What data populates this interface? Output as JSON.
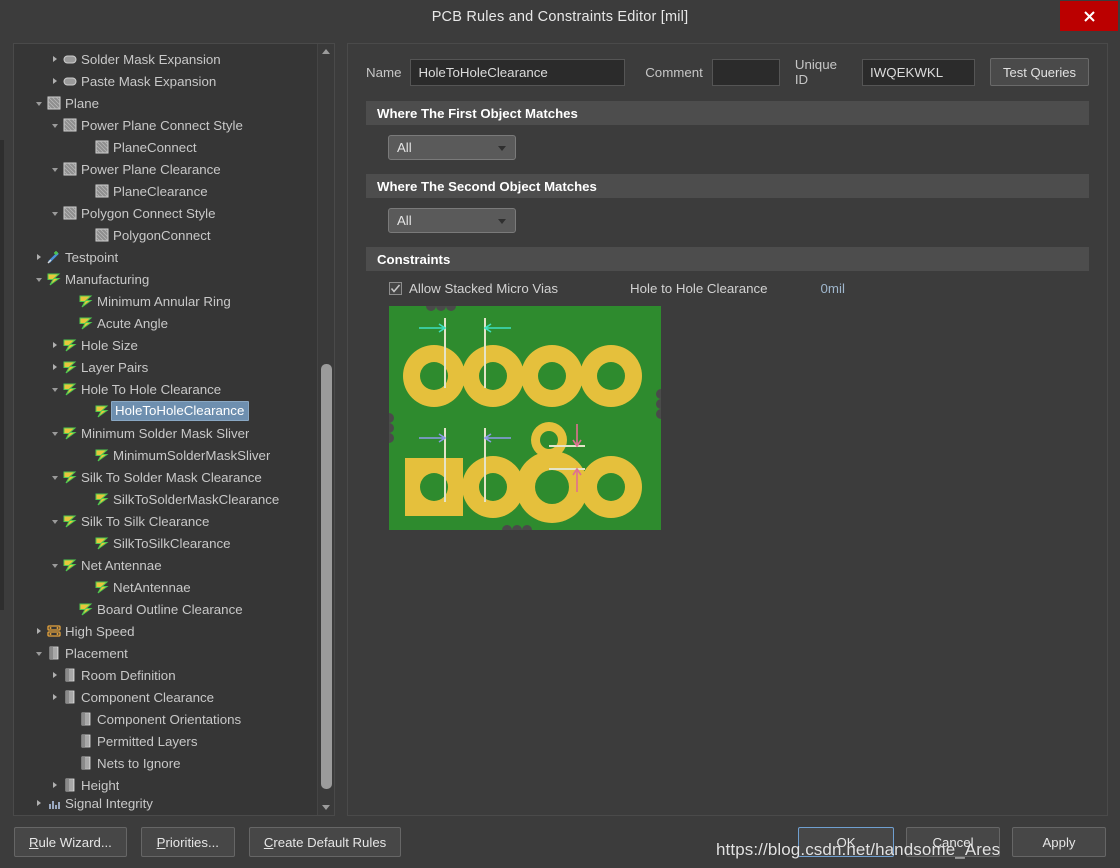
{
  "window": {
    "title": "PCB Rules and Constraints Editor [mil]",
    "close_label": "x",
    "accent_close_color": "#bb0000",
    "selection_color": "#6e8faf"
  },
  "tree": {
    "items": [
      {
        "label": "Solder Mask Expansion",
        "depth": 3,
        "twisty": "collapsed",
        "icon": "mask-oval-icon"
      },
      {
        "label": "Paste Mask Expansion",
        "depth": 3,
        "twisty": "collapsed",
        "icon": "mask-oval-icon"
      },
      {
        "label": "Plane",
        "depth": 2,
        "twisty": "expanded",
        "icon": "plane-icon"
      },
      {
        "label": "Power Plane Connect Style",
        "depth": 3,
        "twisty": "expanded",
        "icon": "plane-icon"
      },
      {
        "label": "PlaneConnect",
        "depth": 5,
        "twisty": "none",
        "icon": "plane-icon"
      },
      {
        "label": "Power Plane Clearance",
        "depth": 3,
        "twisty": "expanded",
        "icon": "plane-icon"
      },
      {
        "label": "PlaneClearance",
        "depth": 5,
        "twisty": "none",
        "icon": "plane-icon"
      },
      {
        "label": "Polygon Connect Style",
        "depth": 3,
        "twisty": "expanded",
        "icon": "plane-icon"
      },
      {
        "label": "PolygonConnect",
        "depth": 5,
        "twisty": "none",
        "icon": "plane-icon"
      },
      {
        "label": "Testpoint",
        "depth": 2,
        "twisty": "collapsed",
        "icon": "testpoint-icon"
      },
      {
        "label": "Manufacturing",
        "depth": 2,
        "twisty": "expanded",
        "icon": "manufacturing-icon"
      },
      {
        "label": "Minimum Annular Ring",
        "depth": 4,
        "twisty": "none",
        "icon": "manufacturing-icon"
      },
      {
        "label": "Acute Angle",
        "depth": 4,
        "twisty": "none",
        "icon": "manufacturing-icon"
      },
      {
        "label": "Hole Size",
        "depth": 3,
        "twisty": "collapsed",
        "icon": "manufacturing-icon"
      },
      {
        "label": "Layer Pairs",
        "depth": 3,
        "twisty": "collapsed",
        "icon": "manufacturing-icon"
      },
      {
        "label": "Hole To Hole Clearance",
        "depth": 3,
        "twisty": "expanded",
        "icon": "manufacturing-icon"
      },
      {
        "label": "HoleToHoleClearance",
        "depth": 5,
        "twisty": "none",
        "icon": "manufacturing-icon",
        "selected": true
      },
      {
        "label": "Minimum Solder Mask Sliver",
        "depth": 3,
        "twisty": "expanded",
        "icon": "manufacturing-icon"
      },
      {
        "label": "MinimumSolderMaskSliver",
        "depth": 5,
        "twisty": "none",
        "icon": "manufacturing-icon"
      },
      {
        "label": "Silk To Solder Mask Clearance",
        "depth": 3,
        "twisty": "expanded",
        "icon": "manufacturing-icon"
      },
      {
        "label": "SilkToSolderMaskClearance",
        "depth": 5,
        "twisty": "none",
        "icon": "manufacturing-icon"
      },
      {
        "label": "Silk To Silk Clearance",
        "depth": 3,
        "twisty": "expanded",
        "icon": "manufacturing-icon"
      },
      {
        "label": "SilkToSilkClearance",
        "depth": 5,
        "twisty": "none",
        "icon": "manufacturing-icon"
      },
      {
        "label": "Net Antennae",
        "depth": 3,
        "twisty": "expanded",
        "icon": "manufacturing-icon"
      },
      {
        "label": "NetAntennae",
        "depth": 5,
        "twisty": "none",
        "icon": "manufacturing-icon"
      },
      {
        "label": "Board Outline Clearance",
        "depth": 4,
        "twisty": "none",
        "icon": "manufacturing-icon"
      },
      {
        "label": "High Speed",
        "depth": 2,
        "twisty": "collapsed",
        "icon": "high-speed-icon"
      },
      {
        "label": "Placement",
        "depth": 2,
        "twisty": "expanded",
        "icon": "placement-icon"
      },
      {
        "label": "Room Definition",
        "depth": 3,
        "twisty": "collapsed",
        "icon": "placement-icon"
      },
      {
        "label": "Component Clearance",
        "depth": 3,
        "twisty": "collapsed",
        "icon": "placement-icon"
      },
      {
        "label": "Component Orientations",
        "depth": 4,
        "twisty": "none",
        "icon": "placement-icon"
      },
      {
        "label": "Permitted Layers",
        "depth": 4,
        "twisty": "none",
        "icon": "placement-icon"
      },
      {
        "label": "Nets to Ignore",
        "depth": 4,
        "twisty": "none",
        "icon": "placement-icon"
      },
      {
        "label": "Height",
        "depth": 3,
        "twisty": "collapsed",
        "icon": "placement-icon"
      },
      {
        "label": "Signal Integrity",
        "depth": 2,
        "twisty": "collapsed",
        "icon": "signal-integrity-icon",
        "clipped": true
      }
    ]
  },
  "form": {
    "name_label": "Name",
    "name_value": "HoleToHoleClearance",
    "comment_label": "Comment",
    "comment_value": "",
    "comment_placeholder": "",
    "unique_id_label": "Unique ID",
    "unique_id_value": "IWQEKWKL",
    "test_queries_label": "Test Queries"
  },
  "sections": {
    "first_object": {
      "heading": "Where The First Object Matches",
      "scope_value": "All"
    },
    "second_object": {
      "heading": "Where The Second Object Matches",
      "scope_value": "All"
    },
    "constraints": {
      "heading": "Constraints",
      "allow_stacked_micro_vias_label": "Allow Stacked Micro Vias",
      "allow_stacked_micro_vias_checked": true,
      "hole_to_hole_clearance_label": "Hole to Hole Clearance",
      "hole_to_hole_clearance_value": "0mil"
    }
  },
  "pcb_preview": {
    "board_color": "#2e8b2e",
    "pad_color": "#e5c03c",
    "arrow_top_color": "#3fe0c0",
    "arrow_bottom_color": "#8b9ce8",
    "arrow_vertical_color": "#e07090"
  },
  "footer": {
    "rule_wizard": "Rule Wizard...",
    "rule_wizard_mnemonic": "R",
    "priorities": "Priorities...",
    "priorities_mnemonic": "P",
    "create_default_rules": "Create Default Rules",
    "create_default_rules_mnemonic": "C",
    "ok": "OK",
    "cancel": "Cancel",
    "apply": "Apply"
  },
  "watermark": {
    "text": "https://blog.csdn.net/handsome_Ares"
  }
}
